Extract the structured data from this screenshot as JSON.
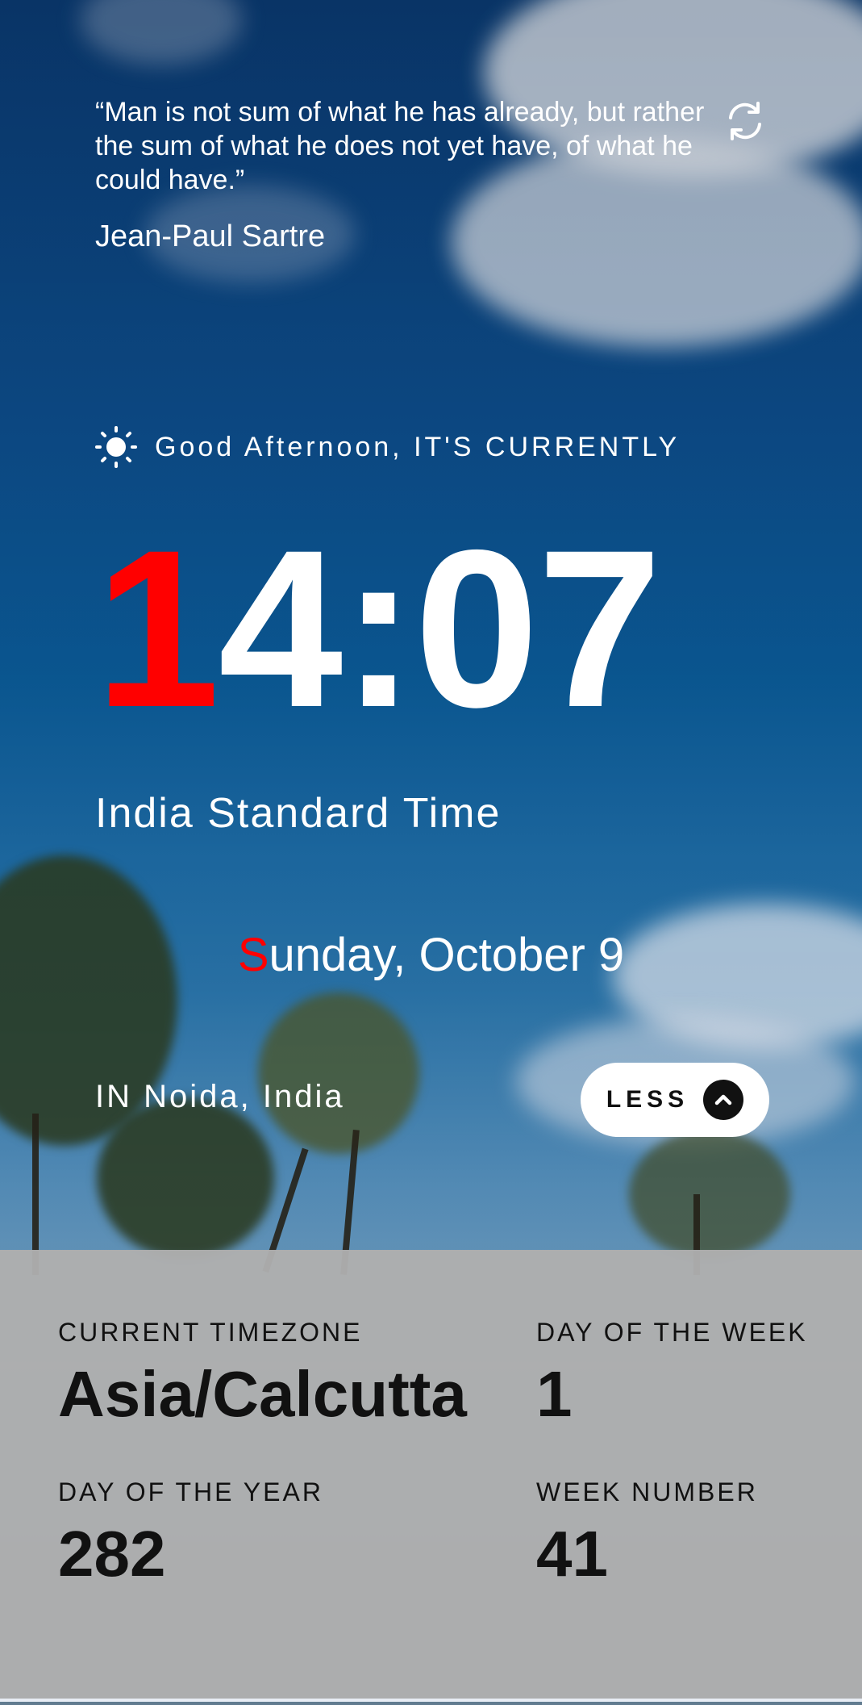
{
  "quote": {
    "text": "“Man is not sum of what he has already, but rather the sum of what he does not yet have, of what he could have.”",
    "author": "Jean-Paul Sartre",
    "refresh_icon": "refresh-icon"
  },
  "greeting": {
    "icon": "sun-icon",
    "text": "Good Afternoon, IT'S CURRENTLY"
  },
  "clock": {
    "first_digit": "1",
    "rest": "4:07",
    "timezone_name": "India Standard Time"
  },
  "date": {
    "first_letter": "S",
    "rest": "unday, October 9"
  },
  "location": {
    "text": "IN Noida, India"
  },
  "toggle": {
    "label": "LESS",
    "icon": "chevron-up-icon"
  },
  "info": {
    "current_timezone_label": "CURRENT TIMEZONE",
    "current_timezone_value": "Asia/Calcutta",
    "day_of_week_label": "DAY OF THE WEEK",
    "day_of_week_value": "1",
    "day_of_year_label": "DAY OF THE YEAR",
    "day_of_year_value": "282",
    "week_number_label": "WEEK NUMBER",
    "week_number_value": "41"
  },
  "colors": {
    "accent": "#ff0000",
    "panel": "#afafaf",
    "text_light": "#ffffff",
    "text_dark": "#111111"
  }
}
